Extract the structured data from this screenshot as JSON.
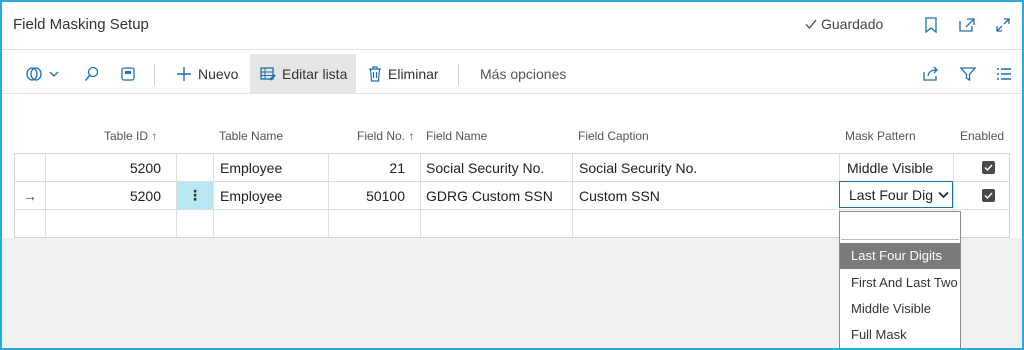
{
  "header": {
    "title": "Field Masking Setup",
    "saved_label": "Guardado"
  },
  "toolbar": {
    "new_label": "Nuevo",
    "edit_list_label": "Editar lista",
    "delete_label": "Eliminar",
    "more_label": "Más opciones"
  },
  "table": {
    "columns": {
      "table_id": "Table ID",
      "table_name": "Table Name",
      "field_no": "Field No.",
      "field_name": "Field Name",
      "field_caption": "Field Caption",
      "mask_pattern": "Mask Pattern",
      "enabled": "Enabled"
    },
    "rows": [
      {
        "table_id": "5200",
        "table_name": "Employee",
        "field_no": "21",
        "field_name": "Social Security No.",
        "field_caption": "Social Security No.",
        "mask_pattern": "Middle Visible",
        "enabled": true
      },
      {
        "table_id": "5200",
        "table_name": "Employee",
        "field_no": "50100",
        "field_name": "GDRG Custom SSN",
        "field_caption": "Custom SSN",
        "mask_pattern": "Last Four Dig",
        "enabled": true
      }
    ]
  },
  "dropdown": {
    "options": [
      "Last Four Digits",
      "First And Last Two",
      "Middle Visible",
      "Full Mask"
    ],
    "selected": "Last Four Digits"
  },
  "colors": {
    "accent": "#2aa8e0",
    "selected_option": "#7a7a7a",
    "row_action": "#b8e8f2"
  }
}
